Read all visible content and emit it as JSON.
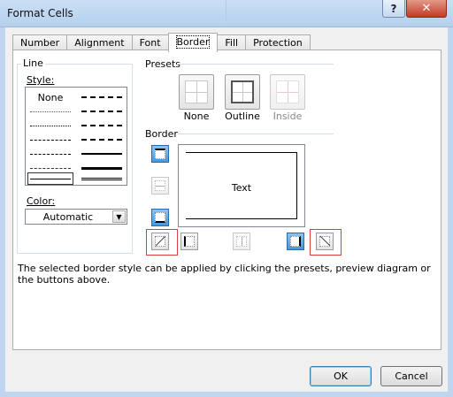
{
  "window": {
    "title": "Format Cells",
    "help_label": "?",
    "close_label": "✕"
  },
  "tabs": [
    {
      "label": "Number"
    },
    {
      "label": "Alignment"
    },
    {
      "label": "Font"
    },
    {
      "label": "Border",
      "active": true
    },
    {
      "label": "Fill"
    },
    {
      "label": "Protection"
    }
  ],
  "line": {
    "group_label": "Line",
    "style_label": "Style:",
    "none_label": "None",
    "color_label": "Color:",
    "color_value": "Automatic"
  },
  "presets": {
    "label": "Presets",
    "items": [
      {
        "label": "None"
      },
      {
        "label": "Outline"
      },
      {
        "label": "Inside"
      }
    ]
  },
  "border": {
    "label": "Border",
    "preview_text": "Text"
  },
  "description": "The selected border style can be applied by clicking the presets, preview diagram or the buttons above.",
  "buttons": {
    "ok": "OK",
    "cancel": "Cancel"
  },
  "colors": {
    "title_bg": "#c9dff5",
    "highlight": "#e03c3c",
    "toggle_on": "#4a98d9"
  }
}
